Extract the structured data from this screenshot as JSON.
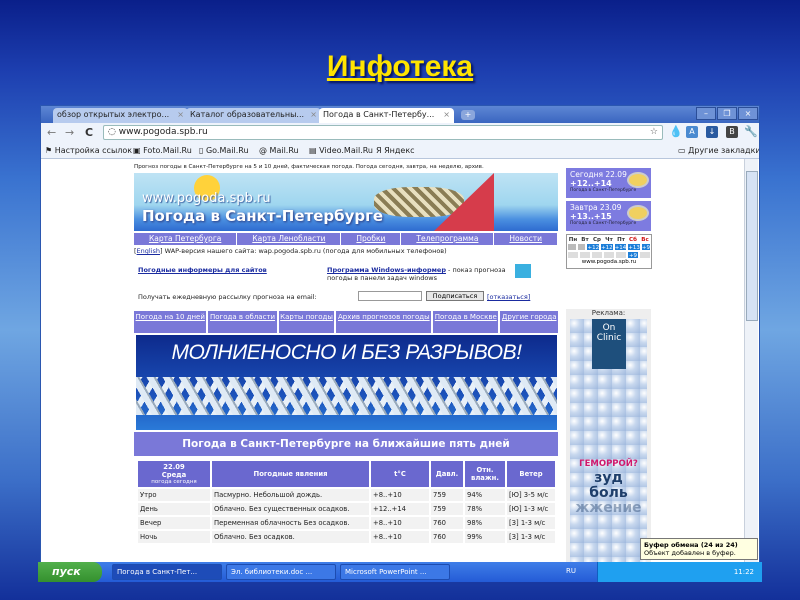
{
  "slide": {
    "title": "Инфотека"
  },
  "browser": {
    "tabs": [
      {
        "label": "обзор открытых электро..."
      },
      {
        "label": "Каталог образовательны..."
      },
      {
        "label": "Погода в Санкт-Петербу..."
      }
    ],
    "new_tab": "+",
    "url": "www.pogoda.spb.ru",
    "bookmarks": [
      "Настройка ссылок",
      "Foto.Mail.Ru",
      "Go.Mail.Ru",
      "Mail.Ru",
      "Video.Mail.Ru",
      "Яндекс"
    ],
    "other_bookmarks": "Другие закладки"
  },
  "site": {
    "tagline": "Прогноз погоды в Санкт-Петербурге на 5 и 10 дней, фактическая погода. Погода сегодня, завтра, на неделю, архив.",
    "banner_url": "www.pogoda.spb.ru",
    "banner_name": "Погода в Санкт-Петербурге",
    "top_nav": [
      "Карта Петербурга",
      "Карта Ленобласти",
      "Пробки",
      "Телепрограмма",
      "Новости"
    ],
    "english": "English",
    "wap_text": "WAP-версия нашего сайта: wap.pogoda.spb.ru (погода для мобильных телефонов)",
    "informers_link": "Погодные информеры для сайтов",
    "windows_link": "Программа Windows-информер",
    "windows_desc": " - показ прогноза погоды в панели задач windows",
    "email_label": "Получать ежедневную рассылку прогноза на email:",
    "email_value": "",
    "subscribe": "Подписаться",
    "unsubscribe": "[отказаться]",
    "nav2": [
      "Погода на 10 дней",
      "Погода в области",
      "Карты погоды",
      "Архив прогнозов погоды",
      "Погода в Москве",
      "Другие города"
    ],
    "ad_headline": "МОЛНИЕНОСНО И БЕЗ РАЗРЫВОВ!",
    "five_days_title": "Погода в Санкт-Петербурге на ближайшие пять дней",
    "table": {
      "date": "22.09",
      "weekday": "Среда",
      "today": "погода сегодня",
      "headers": [
        "Погодные явления",
        "t°C",
        "Давл.",
        "Отн. влажн.",
        "Ветер"
      ],
      "rows": [
        {
          "part": "Утро",
          "weather": "Пасмурно. Небольшой дождь.",
          "t": "+8..+10",
          "p": "759",
          "h": "94%",
          "w": "[Ю] 3-5 м/с"
        },
        {
          "part": "День",
          "weather": "Облачно. Без существенных осадков.",
          "t": "+12..+14",
          "p": "759",
          "h": "78%",
          "w": "[Ю] 1-3 м/с"
        },
        {
          "part": "Вечер",
          "weather": "Переменная облачность Без осадков.",
          "t": "+8..+10",
          "p": "760",
          "h": "98%",
          "w": "[З] 1-3 м/с"
        },
        {
          "part": "Ночь",
          "weather": "Облачно. Без осадков.",
          "t": "+8..+10",
          "p": "760",
          "h": "99%",
          "w": "[З] 1-3 м/с"
        }
      ]
    },
    "widgets": [
      {
        "day": "Сегодня 22.09",
        "temp": "+12..+14",
        "caption": "Погода в Санкт-Петербурге"
      },
      {
        "day": "Завтра 23.09",
        "temp": "+13..+15",
        "caption": "Погода в Санкт-Петербурге"
      }
    ],
    "week": {
      "days": [
        "Пн",
        "Вт",
        "Ср",
        "Чт",
        "Пт",
        "Сб",
        "Вс"
      ],
      "temps": [
        "",
        "",
        "+12",
        "+12",
        "+14",
        "+13",
        "+9"
      ],
      "night": [
        "",
        "",
        "",
        "",
        "",
        "+9",
        ""
      ],
      "site": "www.pogoda.spb.ru"
    },
    "ad_label": "Реклама:",
    "ad2": {
      "logo": "On Clinic",
      "line1": "ГЕМОРРОЙ?",
      "line2": "зуд",
      "line3": "боль",
      "line4": "жжение"
    }
  },
  "tooltip": {
    "title": "Буфер обмена (24 из 24)",
    "text": "Объект добавлен в буфер."
  },
  "taskbar": {
    "start": "пуск",
    "items": [
      "Погода в Санкт-Пет...",
      "Эл. библиотеки.doc ...",
      "Microsoft PowerPoint ..."
    ],
    "lang": "RU",
    "clock": "11:22"
  }
}
